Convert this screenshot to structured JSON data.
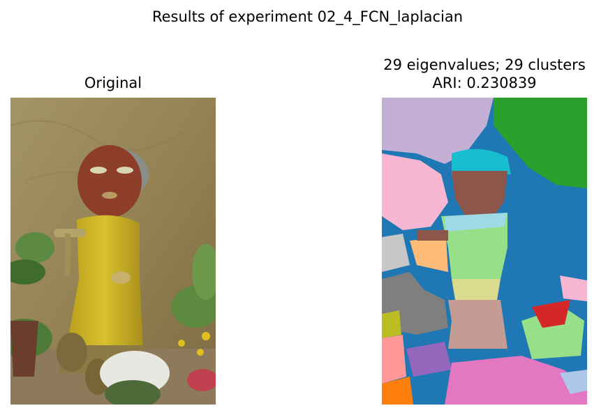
{
  "figure": {
    "suptitle": "Results of experiment 02_4_FCN_laplacian"
  },
  "left_panel": {
    "title": "Original",
    "image": "photo of a painted wooden figure with a yellow robe holding small cups, standing among potted plants and white and yellow flowers in front of a beige textured wall"
  },
  "right_panel": {
    "title_line1": "29 eigenvalues; 29 clusters",
    "title_line2": "ARI: 0.230839",
    "image": "segmentation map of the same photo, each pixel colored by its cluster",
    "palette": [
      "#1f77b4",
      "#ff7f0e",
      "#2ca02c",
      "#d62728",
      "#9467bd",
      "#8c564b",
      "#e377c2",
      "#7f7f7f",
      "#bcbd22",
      "#17becf",
      "#aec7e8",
      "#ffbb78",
      "#98df8a",
      "#ff9896",
      "#c5b0d5",
      "#c49c94",
      "#f7b6d2",
      "#c7c7c7",
      "#dbdb8d",
      "#9edae5"
    ]
  }
}
